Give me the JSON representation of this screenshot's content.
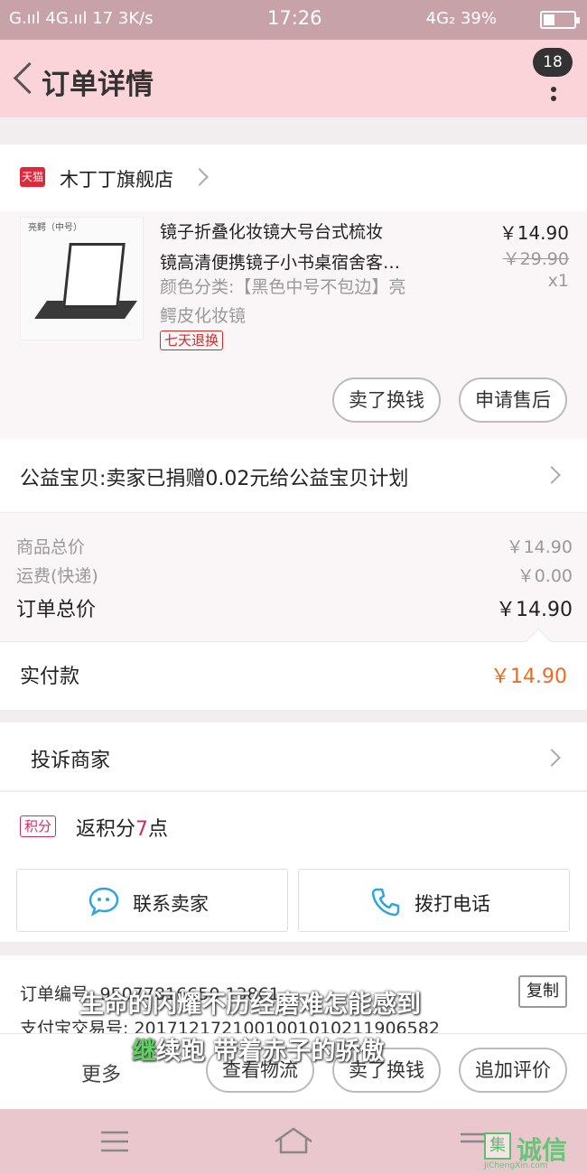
{
  "status_bar": {
    "left": "G.ııl 4G.ııl 17 3K/s",
    "time": "17:26",
    "right": "4G₂ 39%"
  },
  "header": {
    "title": "订单详情",
    "badge_count": "18"
  },
  "store": {
    "platform_tag": "天猫",
    "name": "木丁丁旗舰店"
  },
  "product": {
    "thumb_label": "亮鳄（中号）",
    "title_line1": "镜子折叠化妆镜大号台式梳妆",
    "title_line2": "镜高清便携镜子小书桌宿舍客…",
    "sku_line1": "颜色分类:【黑色中号不包边】亮",
    "sku_line2": "鳄皮化妆镜",
    "tag": "七天退换",
    "price": "￥14.90",
    "original_price": "￥29.90",
    "qty": "x1",
    "btn_sell": "卖了换钱",
    "btn_aftersale": "申请售后"
  },
  "charity": {
    "text": "公益宝贝:卖家已捐赠0.02元给公益宝贝计划"
  },
  "summary": {
    "goods_label": "商品总价",
    "goods_value": "￥14.90",
    "shipping_label": "运费(快递)",
    "shipping_value": "￥0.00",
    "total_label": "订单总价",
    "total_value": "￥14.90"
  },
  "paid": {
    "label": "实付款",
    "value": "￥14.90"
  },
  "complain": {
    "label": "投诉商家"
  },
  "points": {
    "badge": "积分",
    "text_pre": "返积分",
    "num": "7",
    "text_post": "点"
  },
  "actions": {
    "contact": "联系卖家",
    "call": "拨打电话"
  },
  "order_info": {
    "order_no_label": "订单编号: 95077816650 13861",
    "alipay_label": "支付宝交易号: 2017121721001001010211906582",
    "copy": "复制"
  },
  "bottom": {
    "more": "更多",
    "logistics": "查看物流",
    "sell": "卖了换钱",
    "review": "追加评价"
  },
  "subtitles": {
    "line1": "生命的闪耀不历经磨难怎能感到",
    "line2_a": "继",
    "line2_b": "续跑  带着赤子的骄傲"
  },
  "watermark": {
    "text": "诚信",
    "sub": "JiChengXin.com"
  },
  "colors": {
    "header_bg": "#fbd4da",
    "statusbar_bg": "#c7a2a8",
    "accent_orange": "#f06a1e",
    "tmall_red": "#e0283a"
  }
}
